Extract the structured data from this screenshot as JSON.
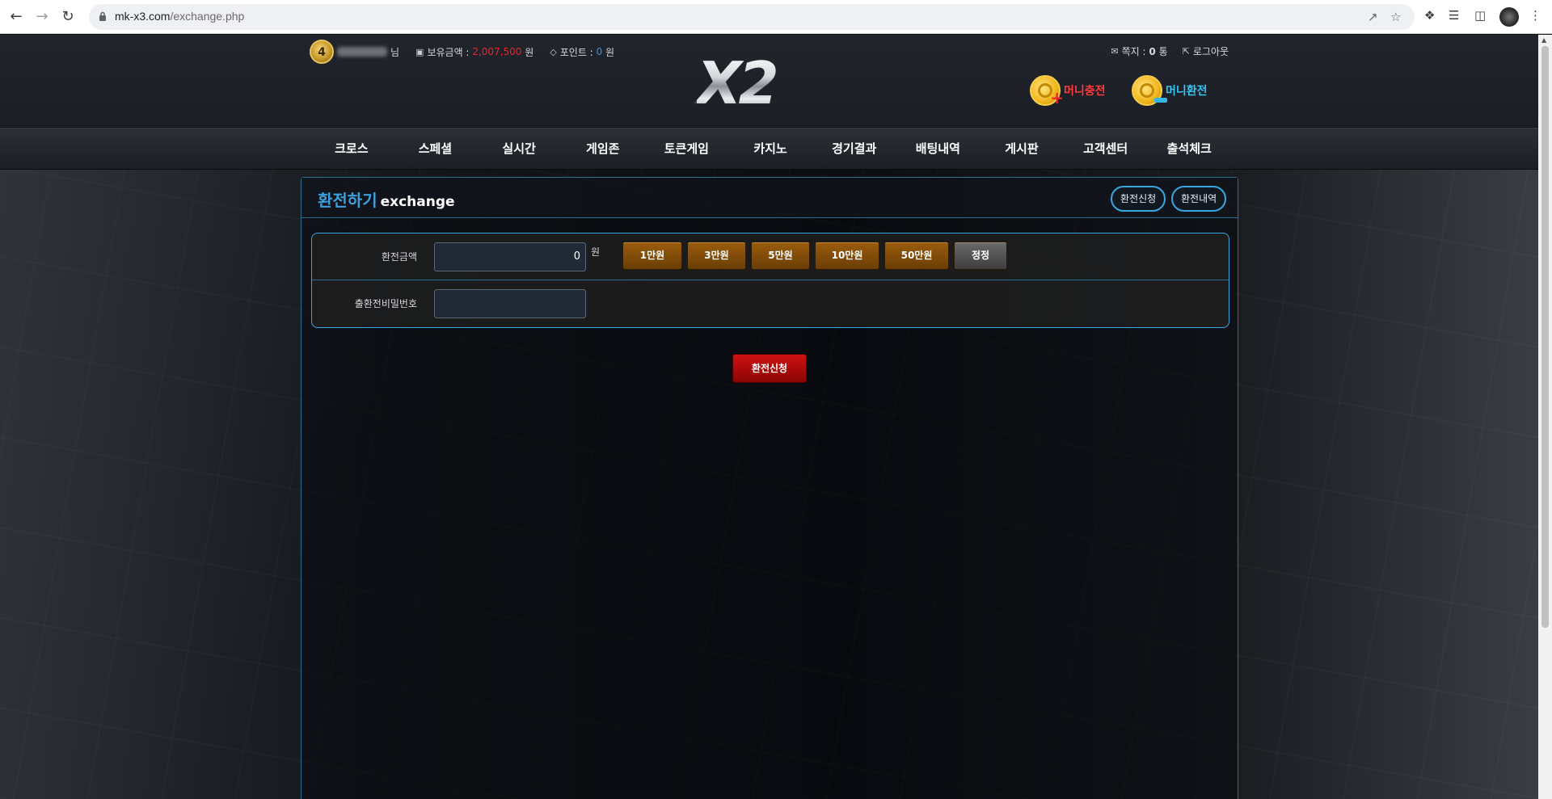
{
  "browser": {
    "url_host": "mk-x3.com",
    "url_path": "/exchange.php"
  },
  "header": {
    "level": "4",
    "name_suffix": "님",
    "balance_label": "보유금액 :",
    "balance_value": "2,007,500",
    "balance_unit": "원",
    "point_label": "포인트 :",
    "point_value": "0",
    "point_unit": "원",
    "message_label": "쪽지 :",
    "message_count": "0",
    "message_unit": "통",
    "logout_label": "로그아웃",
    "logo_text": "X2",
    "deposit_label": "머니충전",
    "withdraw_label": "머니환전",
    "colors": {
      "money": "#e8262b",
      "point": "#3b8ef0",
      "deposit": "#ff3b3b",
      "withdraw": "#35c5f0"
    }
  },
  "menu": {
    "items": [
      "크로스",
      "스페셜",
      "실시간",
      "게임존",
      "토큰게임",
      "카지노",
      "경기결과",
      "배팅내역",
      "게시판",
      "고객센터",
      "출석체크"
    ]
  },
  "panel": {
    "title_ko": "환전하기",
    "title_en": "exchange",
    "btn_request": "환전신청",
    "btn_history": "환전내역"
  },
  "form": {
    "amount_label": "환전금액",
    "amount_value": "0",
    "amount_unit": "원",
    "amount_buttons": [
      "1만원",
      "3만원",
      "5만원",
      "10만원",
      "50만원"
    ],
    "reset_label": "정정",
    "password_label": "출환전비밀번호",
    "password_value": "",
    "submit_label": "환전신청"
  }
}
